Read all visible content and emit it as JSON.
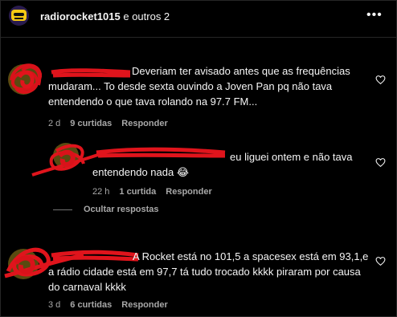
{
  "header": {
    "username": "radiorocket1015",
    "others": " e outros 2",
    "more_icon": "•••"
  },
  "comments": [
    {
      "text": "Deveriam ter avisado antes que as frequências mudaram... To desde sexta ouvindo a Joven Pan pq não tava entendendo o que tava rolando na 97.7 FM...",
      "time": "2 d",
      "likes": "9 curtidas",
      "reply": "Responder"
    },
    {
      "text": "eu liguei ontem e não tava entendendo nada 😂",
      "time": "22 h",
      "likes": "1 curtida",
      "reply": "Responder"
    },
    {
      "text": "A Rocket está no 101,5 a spacesex está em 93,1,e a rádio cidade está em 97,7 tá tudo trocado kkkk piraram por causa do carnaval kkkk",
      "time": "3 d",
      "likes": "6 curtidas",
      "reply": "Responder"
    }
  ],
  "hide_replies": "Ocultar respostas",
  "colors": {
    "background": "#000000",
    "text": "#f5f5f5",
    "secondary": "#a8a8a8",
    "redaction": "#e0141c"
  }
}
